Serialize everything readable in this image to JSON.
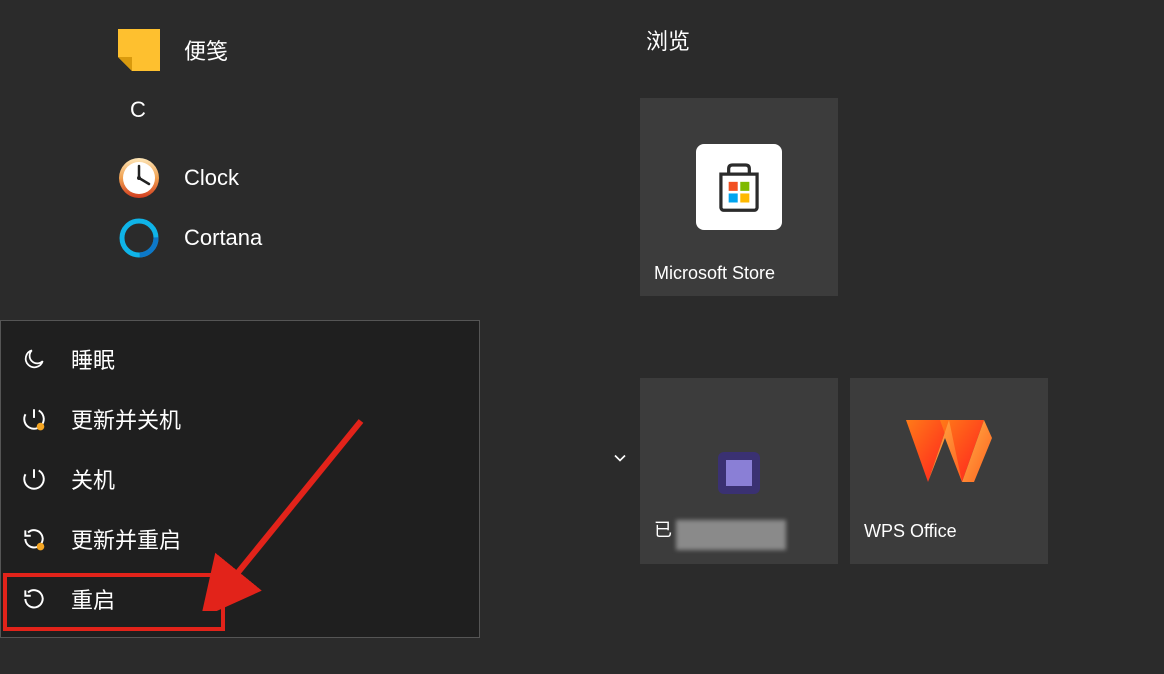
{
  "appList": {
    "stickyNotes": "便笺",
    "sectionLetter": "C",
    "clock": "Clock",
    "cortana": "Cortana"
  },
  "powerMenu": {
    "sleep": "睡眠",
    "updateShutdown": "更新并关机",
    "shutdown": "关机",
    "updateRestart": "更新并重启",
    "restart": "重启"
  },
  "tiles": {
    "header": "浏览",
    "store": "Microsoft Store",
    "hiddenApp": "已",
    "wps": "WPS Office"
  }
}
